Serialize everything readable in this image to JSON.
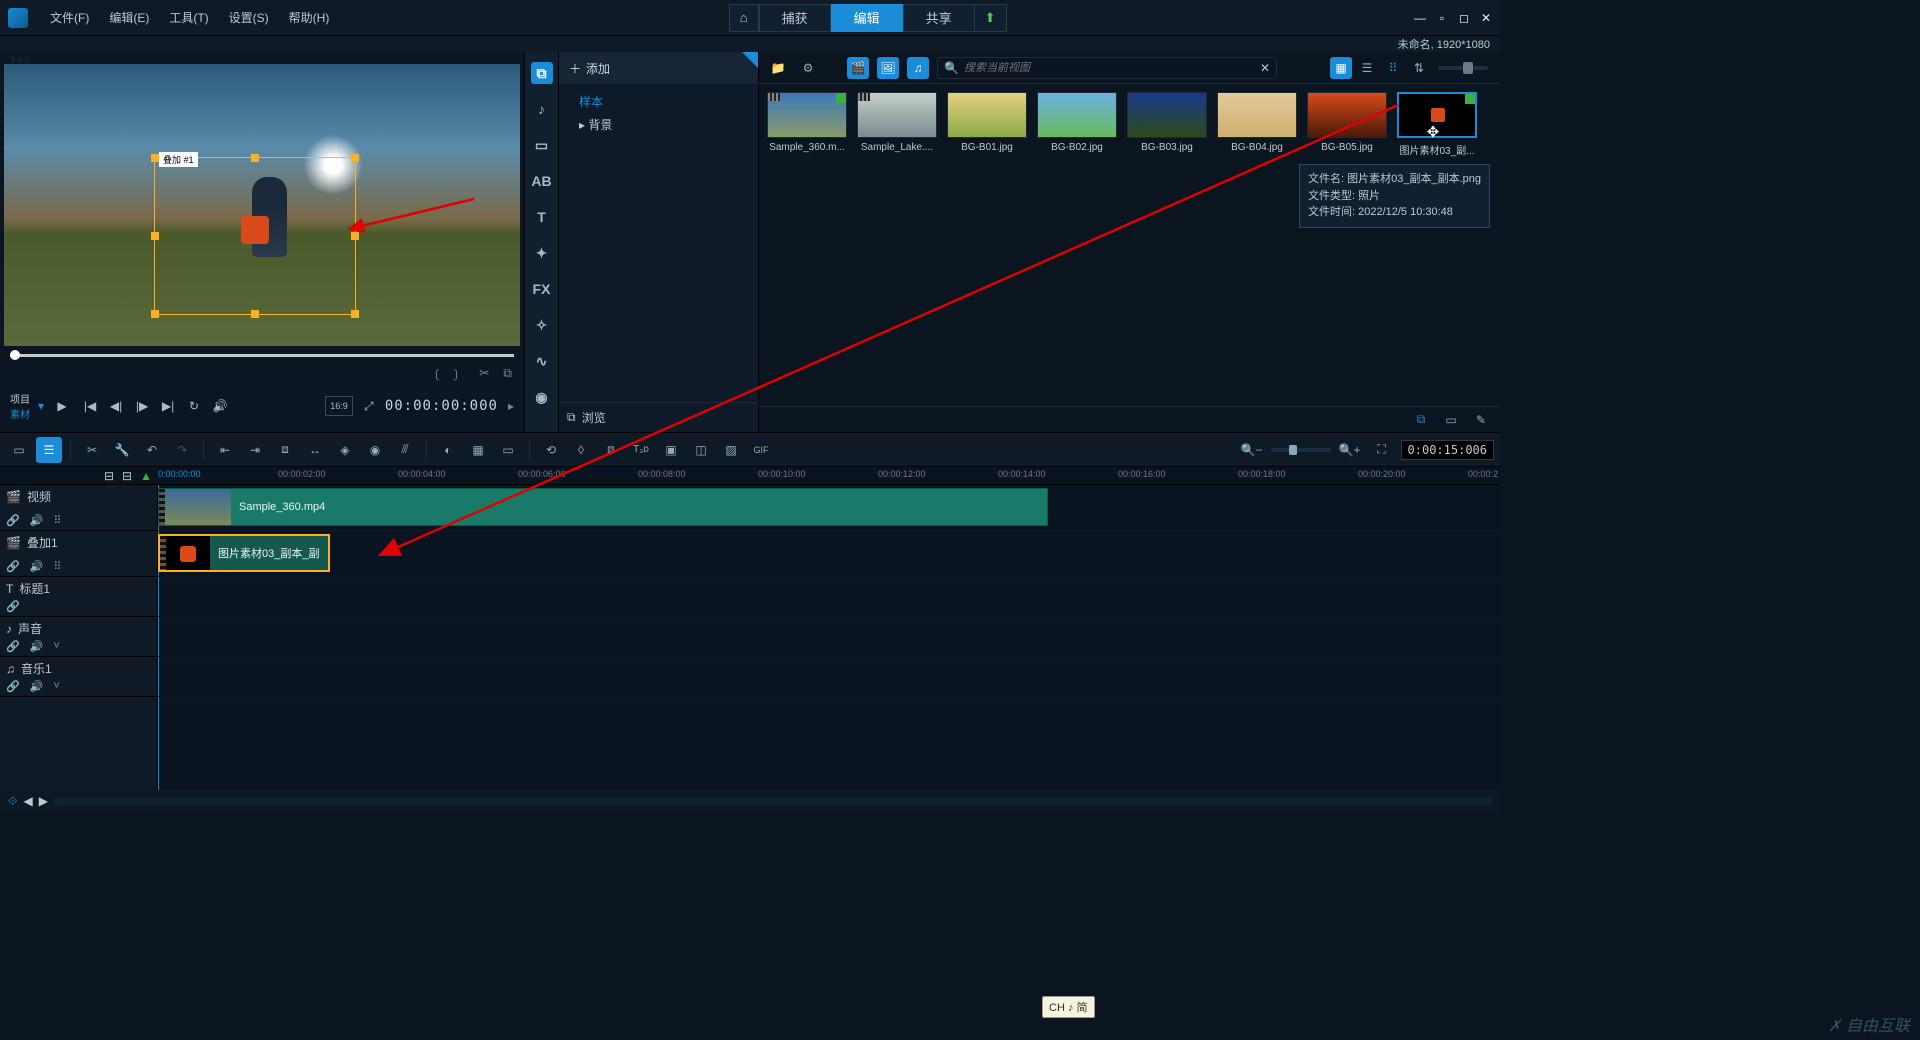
{
  "menubar": {
    "items": [
      "文件(F)",
      "编辑(E)",
      "工具(T)",
      "设置(S)",
      "帮助(H)"
    ],
    "tabs": {
      "capture": "捕获",
      "edit": "编辑",
      "share": "共享"
    },
    "title_right": "未命名, 1920*1080"
  },
  "preview": {
    "overlay_label": "叠加 #1",
    "project_label": "项目",
    "clip_label": "素材",
    "aspect": "16:9",
    "timecode": "00:00:00:000"
  },
  "media": {
    "add": "添加",
    "tree": {
      "sample": "样本",
      "background": "背景"
    },
    "browse": "浏览",
    "search_placeholder": "搜索当前视图",
    "thumbs": [
      {
        "label": "Sample_360.m..."
      },
      {
        "label": "Sample_Lake...."
      },
      {
        "label": "BG-B01.jpg"
      },
      {
        "label": "BG-B02.jpg"
      },
      {
        "label": "BG-B03.jpg"
      },
      {
        "label": "BG-B04.jpg"
      },
      {
        "label": "BG-B05.jpg"
      },
      {
        "label": "图片素材03_副..."
      }
    ],
    "tooltip": {
      "l1": "文件名: 图片素材03_副本_副本.png",
      "l2": "文件类型: 照片",
      "l3": "文件时间: 2022/12/5 10:30:48"
    }
  },
  "timeline": {
    "cur_tc": "0:00:15:006",
    "ruler": [
      "0:00:00:00",
      "00:00:02:00",
      "00:00:04:00",
      "00:00:06:00",
      "00:00:08:00",
      "00:00:10:00",
      "00:00:12:00",
      "00:00:14:00",
      "00:00:16:00",
      "00:00:18:00",
      "00:00:20:00",
      "00:00:2"
    ],
    "tracks": {
      "video": "视频",
      "overlay": "叠加1",
      "title": "标题1",
      "sound": "声音",
      "music": "音乐1"
    },
    "clip_video": "Sample_360.mp4",
    "clip_overlay": "图片素材03_副本_副"
  },
  "ime": "CH ♪ 简",
  "watermark": "✗ 自由互联"
}
